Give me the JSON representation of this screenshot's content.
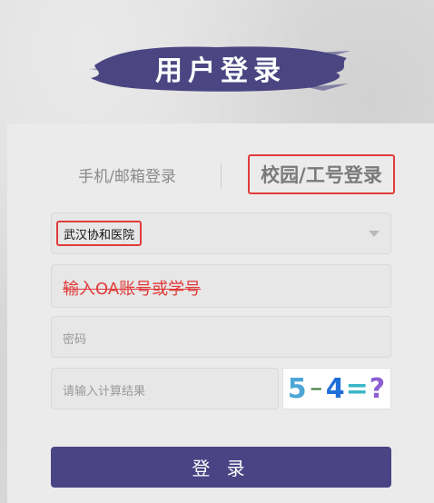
{
  "header": {
    "title": "用户登录"
  },
  "tabs": [
    {
      "label": "手机/邮箱登录",
      "selected": false
    },
    {
      "label": "校园/工号登录",
      "selected": true
    }
  ],
  "form": {
    "hospital": {
      "value": "武汉协和医院"
    },
    "account": {
      "placeholder": "输入OA账号或学号"
    },
    "password": {
      "placeholder": "密码"
    },
    "captcha": {
      "placeholder": "请输入计算结果",
      "image_text": [
        "5",
        "−",
        "4",
        "=",
        "?"
      ]
    },
    "submit_label": "登 录"
  },
  "colors": {
    "brand": "#4a4384",
    "highlight_box": "#e23b3b",
    "panel_bg": "#ebebeb"
  },
  "icons": {
    "select_caret": "chevron-down-icon"
  }
}
